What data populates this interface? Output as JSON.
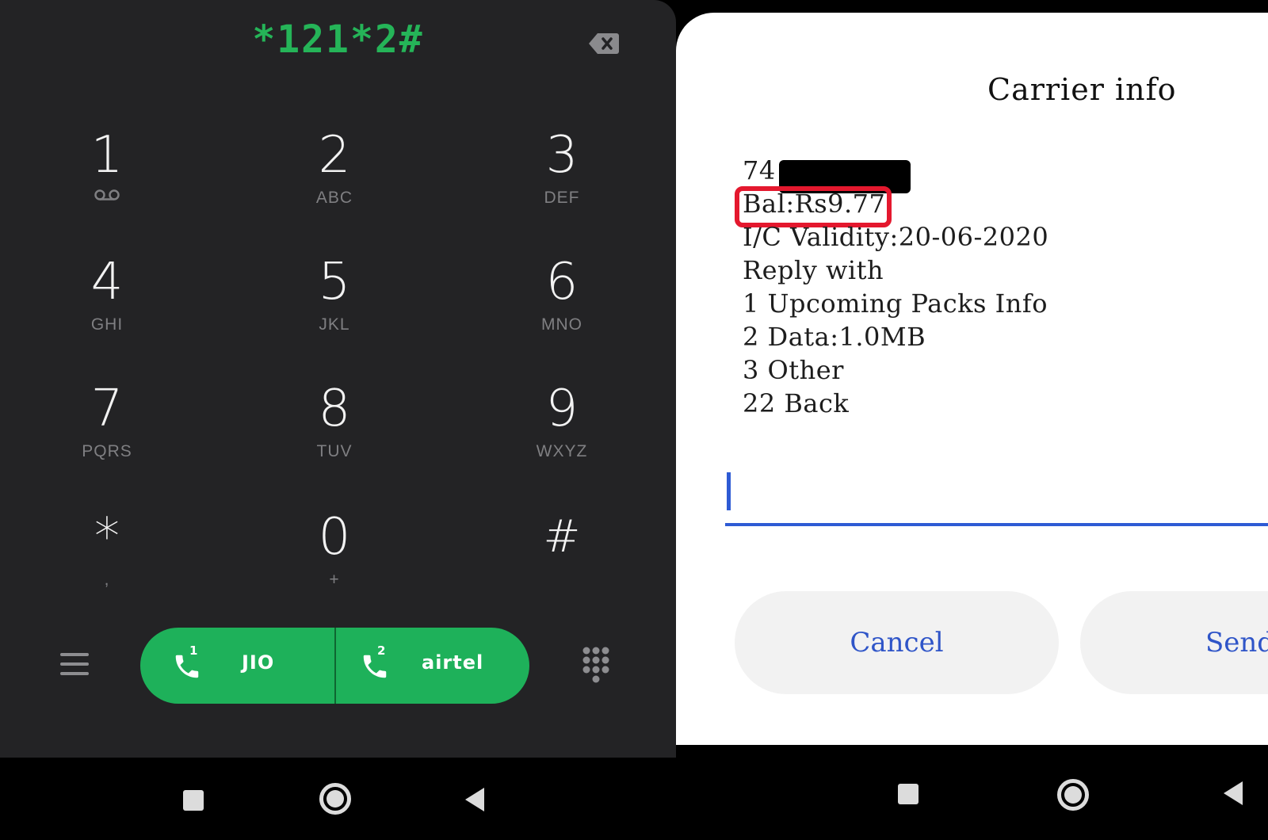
{
  "dialer": {
    "display": "*121*2#",
    "keys": [
      {
        "digit": "1",
        "letters": ""
      },
      {
        "digit": "2",
        "letters": "ABC"
      },
      {
        "digit": "3",
        "letters": "DEF"
      },
      {
        "digit": "4",
        "letters": "GHI"
      },
      {
        "digit": "5",
        "letters": "JKL"
      },
      {
        "digit": "6",
        "letters": "MNO"
      },
      {
        "digit": "7",
        "letters": "PQRS"
      },
      {
        "digit": "8",
        "letters": "TUV"
      },
      {
        "digit": "9",
        "letters": "WXYZ"
      },
      {
        "digit": "*",
        "letters": ","
      },
      {
        "digit": "0",
        "letters": "+"
      },
      {
        "digit": "#",
        "letters": ""
      }
    ],
    "sim1": {
      "slot": "1",
      "label": "JIO"
    },
    "sim2": {
      "slot": "2",
      "label": "airtel"
    },
    "icons": {
      "backspace": "backspace-icon",
      "voicemail": "voicemail-icon",
      "menu": "menu-icon",
      "dialpad": "dialpad-icon",
      "call": "phone-icon"
    },
    "colors": {
      "background": "#232325",
      "accent": "#1eb15a",
      "display_text": "#25b458"
    }
  },
  "dialog": {
    "title": "Carrier info",
    "lines": [
      "74",
      "Bal:Rs9.77",
      "I/C Validity:20-06-2020",
      "Reply with",
      "1 Upcoming Packs Info",
      "2 Data:1.0MB",
      "3 Other",
      "22 Back"
    ],
    "reply_value": "",
    "cancel_label": "Cancel",
    "send_label": "Send",
    "colors": {
      "button_text": "#2f55c8",
      "highlight_box": "#e4182e",
      "input_underline": "#2e5bd4"
    }
  },
  "navigation": {
    "icons": [
      "recents-icon",
      "home-icon",
      "back-icon"
    ]
  }
}
